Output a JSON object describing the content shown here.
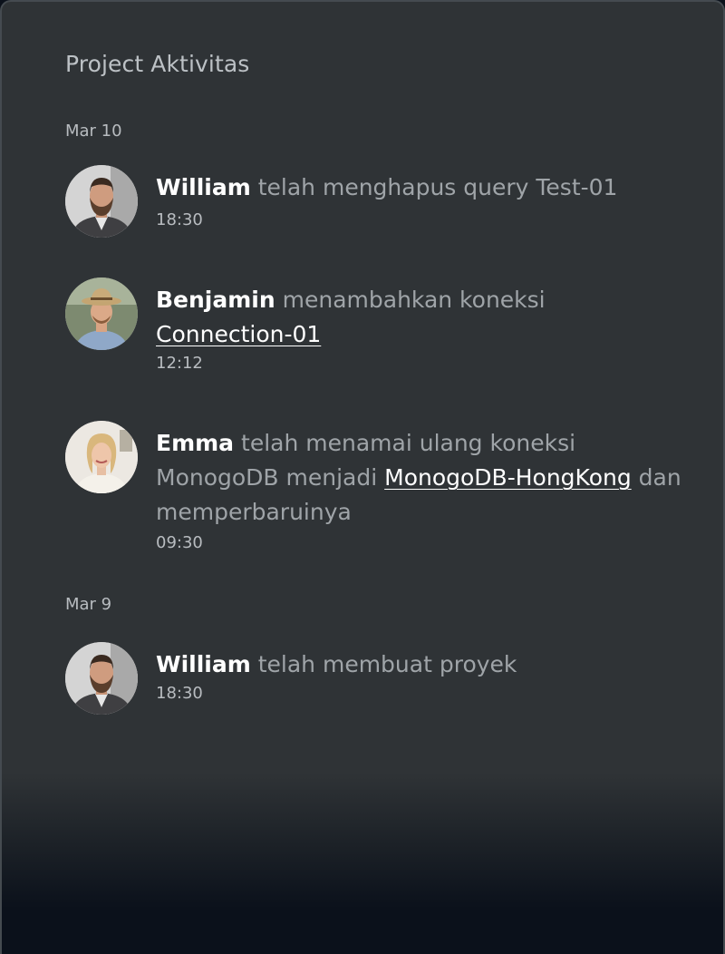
{
  "panel": {
    "title": "Project Aktivitas"
  },
  "groups": [
    {
      "date": "Mar 10",
      "entries": [
        {
          "user": "William",
          "action": "telah menghapus query Test-01",
          "time": "18:30"
        },
        {
          "user": "Benjamin",
          "action": "menambahkan koneksi",
          "link": "Connection-01",
          "time": "12:12"
        },
        {
          "user": "Emma",
          "action": "telah menamai ulang koneksi MonogoDB menjadi",
          "link": "MonogoDB-HongKong",
          "action_suffix": "dan memperbaruinya",
          "time": "09:30"
        }
      ]
    },
    {
      "date": "Mar 9",
      "entries": [
        {
          "user": "William",
          "action": "telah membuat proyek",
          "time": "18:30"
        }
      ]
    }
  ],
  "colors": {
    "panel_bg": "#2f3336",
    "page_bg": "#0b111b",
    "name": "#ffffff",
    "action": "#9fa4a8",
    "meta": "#b8bcc0"
  }
}
